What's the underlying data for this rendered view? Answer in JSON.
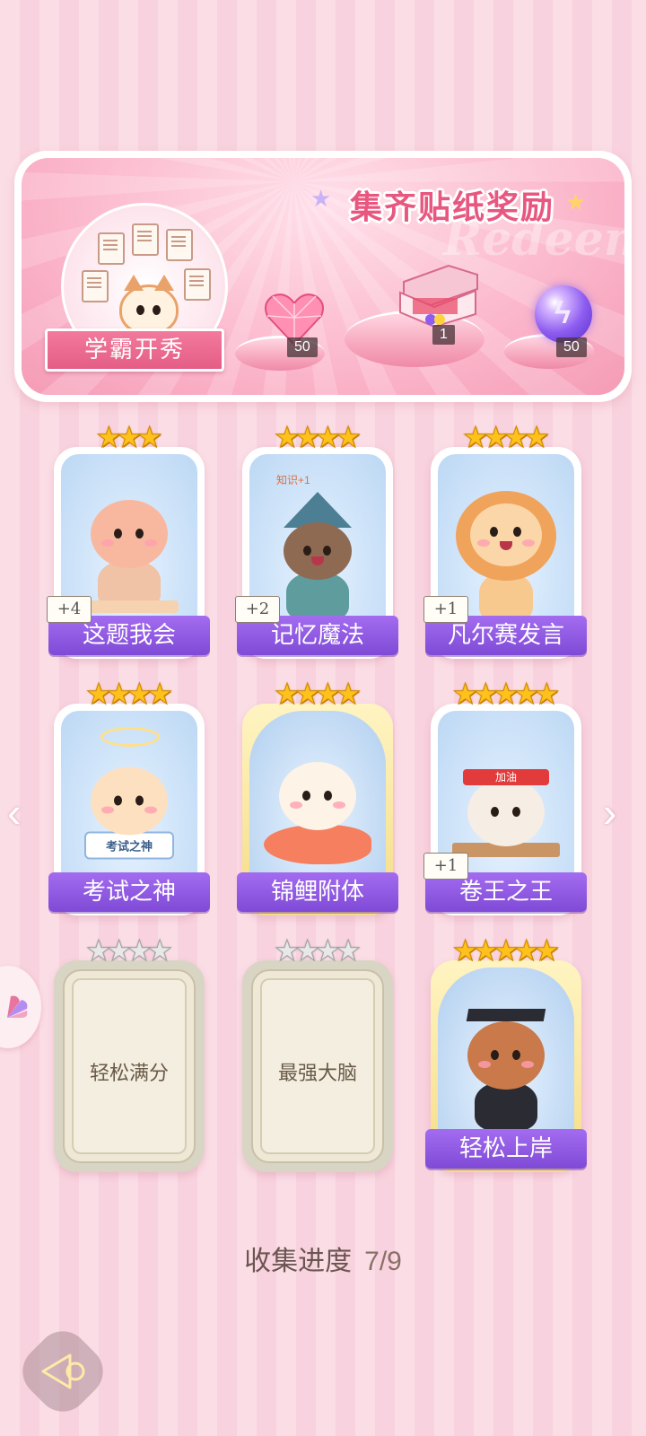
{
  "banner": {
    "title": "集齐贴纸奖励",
    "watermark": "Redeem",
    "scholar_label": "学霸开秀",
    "rewards": [
      {
        "icon": "pink-heart-gem-icon",
        "qty": "50"
      },
      {
        "icon": "gift-box-icon",
        "qty": "1"
      },
      {
        "icon": "purple-energy-orb-icon",
        "qty": "50"
      }
    ]
  },
  "stickers": [
    {
      "name": "这题我会",
      "stars": 3,
      "badge": "+4",
      "state": "collected",
      "animal": "bear"
    },
    {
      "name": "记忆魔法",
      "stars": 4,
      "badge": "+2",
      "state": "collected",
      "animal": "otter-wizard",
      "art_text": "知识+1"
    },
    {
      "name": "凡尔赛发言",
      "stars": 4,
      "badge": "+1",
      "state": "collected",
      "animal": "lion"
    },
    {
      "name": "考试之神",
      "stars": 4,
      "badge": "",
      "state": "collected",
      "animal": "angel-cat",
      "art_text": "考试之神"
    },
    {
      "name": "锦鲤附体",
      "stars": 4,
      "badge": "",
      "state": "gold",
      "animal": "bear-koi"
    },
    {
      "name": "卷王之王",
      "stars": 5,
      "badge": "+1",
      "state": "collected",
      "animal": "cat-studying",
      "art_text": "加油"
    },
    {
      "name": "轻松满分",
      "stars": 4,
      "badge": "",
      "state": "locked"
    },
    {
      "name": "最强大脑",
      "stars": 4,
      "badge": "",
      "state": "locked"
    },
    {
      "name": "轻松上岸",
      "stars": 5,
      "badge": "",
      "state": "gold",
      "animal": "squirrel-graduate"
    }
  ],
  "progress": {
    "label": "收集进度",
    "value": "7/9"
  },
  "nav": {
    "prev_icon": "chevron-left-icon",
    "next_icon": "chevron-right-icon"
  },
  "colors": {
    "accent_pink": "#e8577f",
    "ribbon_purple": "#8f59e2",
    "star_gold": "#ffc21c"
  }
}
